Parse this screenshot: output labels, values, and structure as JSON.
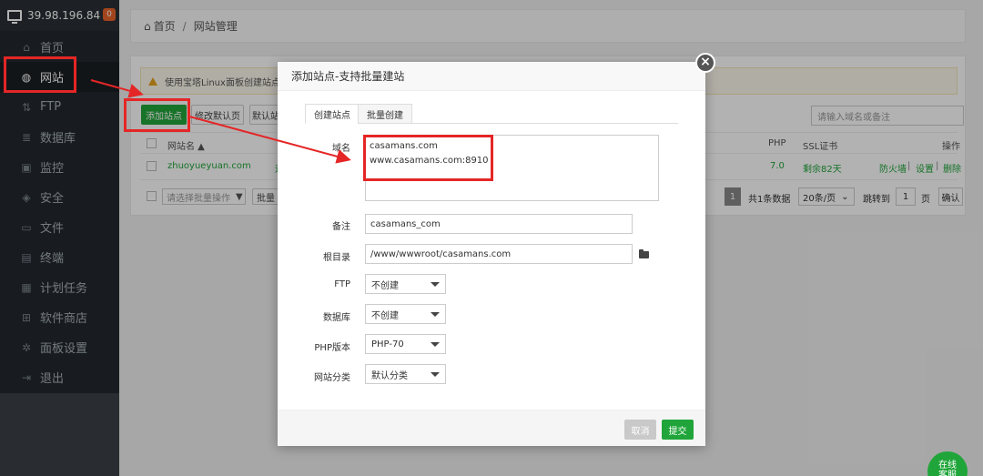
{
  "sidebar": {
    "server_ip": "39.98.196.84",
    "badge": "0",
    "items": [
      {
        "label": "首页",
        "icon": "home-icon",
        "glyph": "⌂"
      },
      {
        "label": "网站",
        "icon": "globe-icon",
        "glyph": "◍"
      },
      {
        "label": "FTP",
        "icon": "ftp-icon",
        "glyph": "⇅"
      },
      {
        "label": "数据库",
        "icon": "database-icon",
        "glyph": "≣"
      },
      {
        "label": "监控",
        "icon": "monitor-icon",
        "glyph": "▣"
      },
      {
        "label": "安全",
        "icon": "shield-icon",
        "glyph": "◈"
      },
      {
        "label": "文件",
        "icon": "folder-icon",
        "glyph": "▭"
      },
      {
        "label": "终端",
        "icon": "terminal-icon",
        "glyph": "▤"
      },
      {
        "label": "计划任务",
        "icon": "calendar-icon",
        "glyph": "▦"
      },
      {
        "label": "软件商店",
        "icon": "grid-icon",
        "glyph": "⊞"
      },
      {
        "label": "面板设置",
        "icon": "gear-icon",
        "glyph": "✲"
      },
      {
        "label": "退出",
        "icon": "logout-icon",
        "glyph": "⇥"
      }
    ]
  },
  "breadcrumb": {
    "home": "首页",
    "current": "网站管理"
  },
  "notice": "使用宝塔Linux面板创建站点时会",
  "toolbar": {
    "add_site": "添加站点",
    "edit_default": "修改默认页",
    "default_site": "默认站",
    "search_placeholder": "请输入域名或备注"
  },
  "table": {
    "headers": {
      "name": "网站名",
      "php": "PHP",
      "ssl": "SSL证书",
      "ops": "操作"
    },
    "row": {
      "name": "zhuoyueyuan.com",
      "status": "运",
      "php": "7.0",
      "ssl": "剩余82天",
      "firewall": "防火墙",
      "settings": "设置",
      "delete": "删除",
      "sep": "|"
    }
  },
  "footer_bar": {
    "batch_select": "请选择批量操作",
    "batch_btn": "批量",
    "page": "1",
    "total": "共1条数据",
    "per_page": "20条/页",
    "goto": "跳转到",
    "goto_page": "1",
    "page_unit": "页",
    "confirm": "确认"
  },
  "modal": {
    "title": "添加站点-支持批量建站",
    "tabs": [
      "创建站点",
      "批量创建"
    ],
    "labels": {
      "domain": "域名",
      "remark": "备注",
      "root": "根目录",
      "ftp": "FTP",
      "db": "数据库",
      "php": "PHP版本",
      "category": "网站分类"
    },
    "values": {
      "domain_line1": "casamans.com",
      "domain_line2": "www.casamans.com:8910",
      "remark": "casamans_com",
      "root": "/www/wwwroot/casamans.com",
      "ftp": "不创建",
      "db": "不创建",
      "php": "PHP-70",
      "category": "默认分类"
    },
    "cancel": "取消",
    "submit": "提交",
    "close": "×"
  },
  "chat": {
    "line1": "在线",
    "line2": "客服"
  },
  "colors": {
    "brand_green": "#20a53a",
    "highlight_red": "#e52626",
    "sidebar_bg": "#23292f"
  }
}
